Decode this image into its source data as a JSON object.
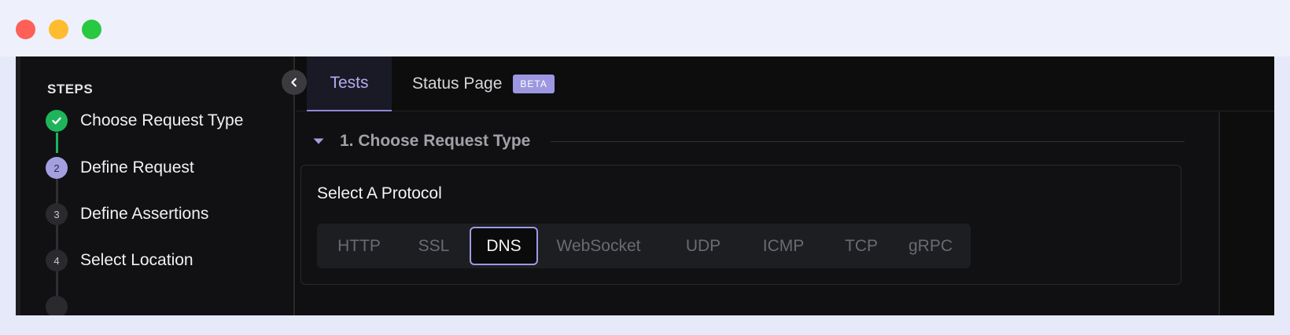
{
  "window": {
    "controls": [
      "close",
      "minimize",
      "maximize"
    ],
    "colors": {
      "close": "#fe5f57",
      "minimize": "#febc2e",
      "maximize": "#28c840"
    }
  },
  "sidebar": {
    "heading": "STEPS",
    "steps": [
      {
        "number": "",
        "label": "Choose Request Type",
        "state": "done"
      },
      {
        "number": "2",
        "label": "Define Request",
        "state": "active"
      },
      {
        "number": "3",
        "label": "Define Assertions",
        "state": "pending"
      },
      {
        "number": "4",
        "label": "Select Location",
        "state": "pending"
      }
    ],
    "collapse_icon": "chevron-left-icon"
  },
  "tabs": [
    {
      "label": "Tests",
      "active": true
    },
    {
      "label": "Status Page",
      "badge": "BETA",
      "active": false
    }
  ],
  "section": {
    "title": "1. Choose Request Type",
    "expanded": true,
    "protocol_prompt": "Select A Protocol",
    "protocols": [
      "HTTP",
      "SSL",
      "DNS",
      "WebSocket",
      "UDP",
      "ICMP",
      "TCP",
      "gRPC"
    ],
    "selected_protocol": "DNS"
  },
  "colors": {
    "accent": "#9f99e6",
    "success": "#1fb45b",
    "background": "#0d0d0e"
  }
}
